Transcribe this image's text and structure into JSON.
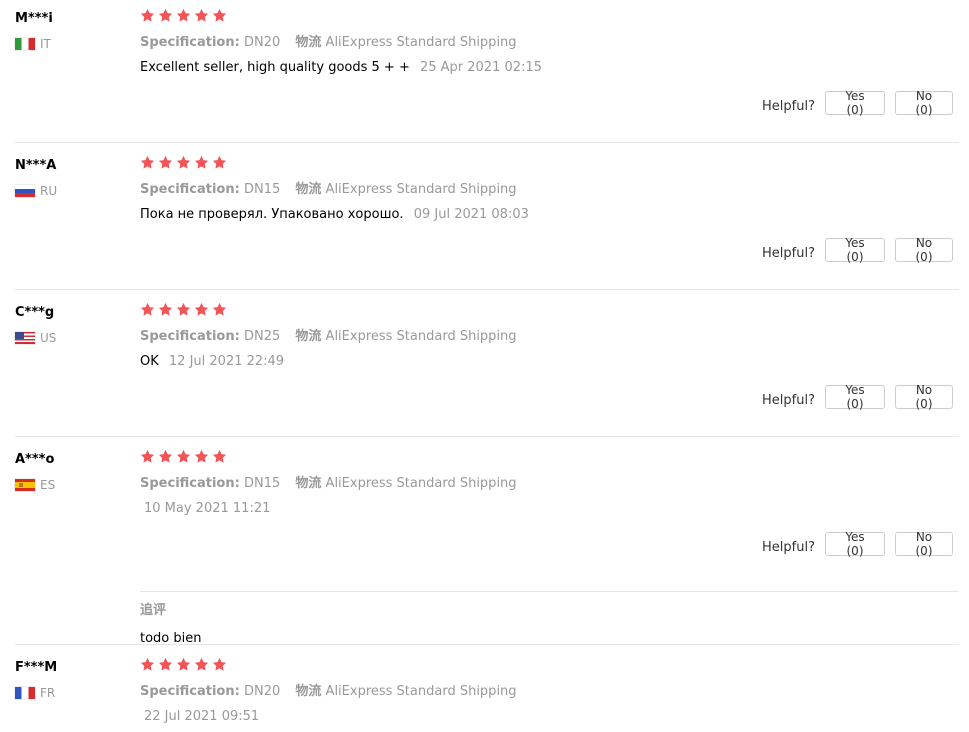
{
  "reviews": [
    {
      "user": "M***i",
      "country": "IT",
      "stars": 5,
      "spec_label": "Specification:",
      "spec_value": "DN20",
      "shipping_label": "物流",
      "shipping_value": "AliExpress Standard Shipping",
      "text": "Excellent seller, high quality goods 5 + +",
      "date": "25 Apr 2021 02:15",
      "helpful_label": "Helpful?",
      "yes_label": "Yes (0)",
      "no_label": "No (0)"
    },
    {
      "user": "N***A",
      "country": "RU",
      "stars": 5,
      "spec_label": "Specification:",
      "spec_value": "DN15",
      "shipping_label": "物流",
      "shipping_value": "AliExpress Standard Shipping",
      "text": "Пока не проверял. Упаковано хорошо.",
      "date": "09 Jul 2021 08:03",
      "helpful_label": "Helpful?",
      "yes_label": "Yes (0)",
      "no_label": "No (0)"
    },
    {
      "user": "C***g",
      "country": "US",
      "stars": 5,
      "spec_label": "Specification:",
      "spec_value": "DN25",
      "shipping_label": "物流",
      "shipping_value": "AliExpress Standard Shipping",
      "text": "OK",
      "date": "12 Jul 2021 22:49",
      "helpful_label": "Helpful?",
      "yes_label": "Yes (0)",
      "no_label": "No (0)"
    },
    {
      "user": "A***o",
      "country": "ES",
      "stars": 5,
      "spec_label": "Specification:",
      "spec_value": "DN15",
      "shipping_label": "物流",
      "shipping_value": "AliExpress Standard Shipping",
      "text": "",
      "date": "10 May 2021 11:21",
      "helpful_label": "Helpful?",
      "yes_label": "Yes (0)",
      "no_label": "No (0)",
      "additional_title": "追评",
      "additional_text": "todo bien"
    },
    {
      "user": "F***M",
      "country": "FR",
      "stars": 5,
      "spec_label": "Specification:",
      "spec_value": "DN20",
      "shipping_label": "物流",
      "shipping_value": "AliExpress Standard Shipping",
      "text": "",
      "date": "22 Jul 2021 09:51"
    }
  ],
  "colors": {
    "star": "#f25557",
    "muted_text": "#999999",
    "divider": "#e6e6e6"
  },
  "icons": {
    "star": "star-icon",
    "flag_it": "italy-flag-icon",
    "flag_ru": "russia-flag-icon",
    "flag_us": "usa-flag-icon",
    "flag_es": "spain-flag-icon",
    "flag_fr": "france-flag-icon"
  }
}
